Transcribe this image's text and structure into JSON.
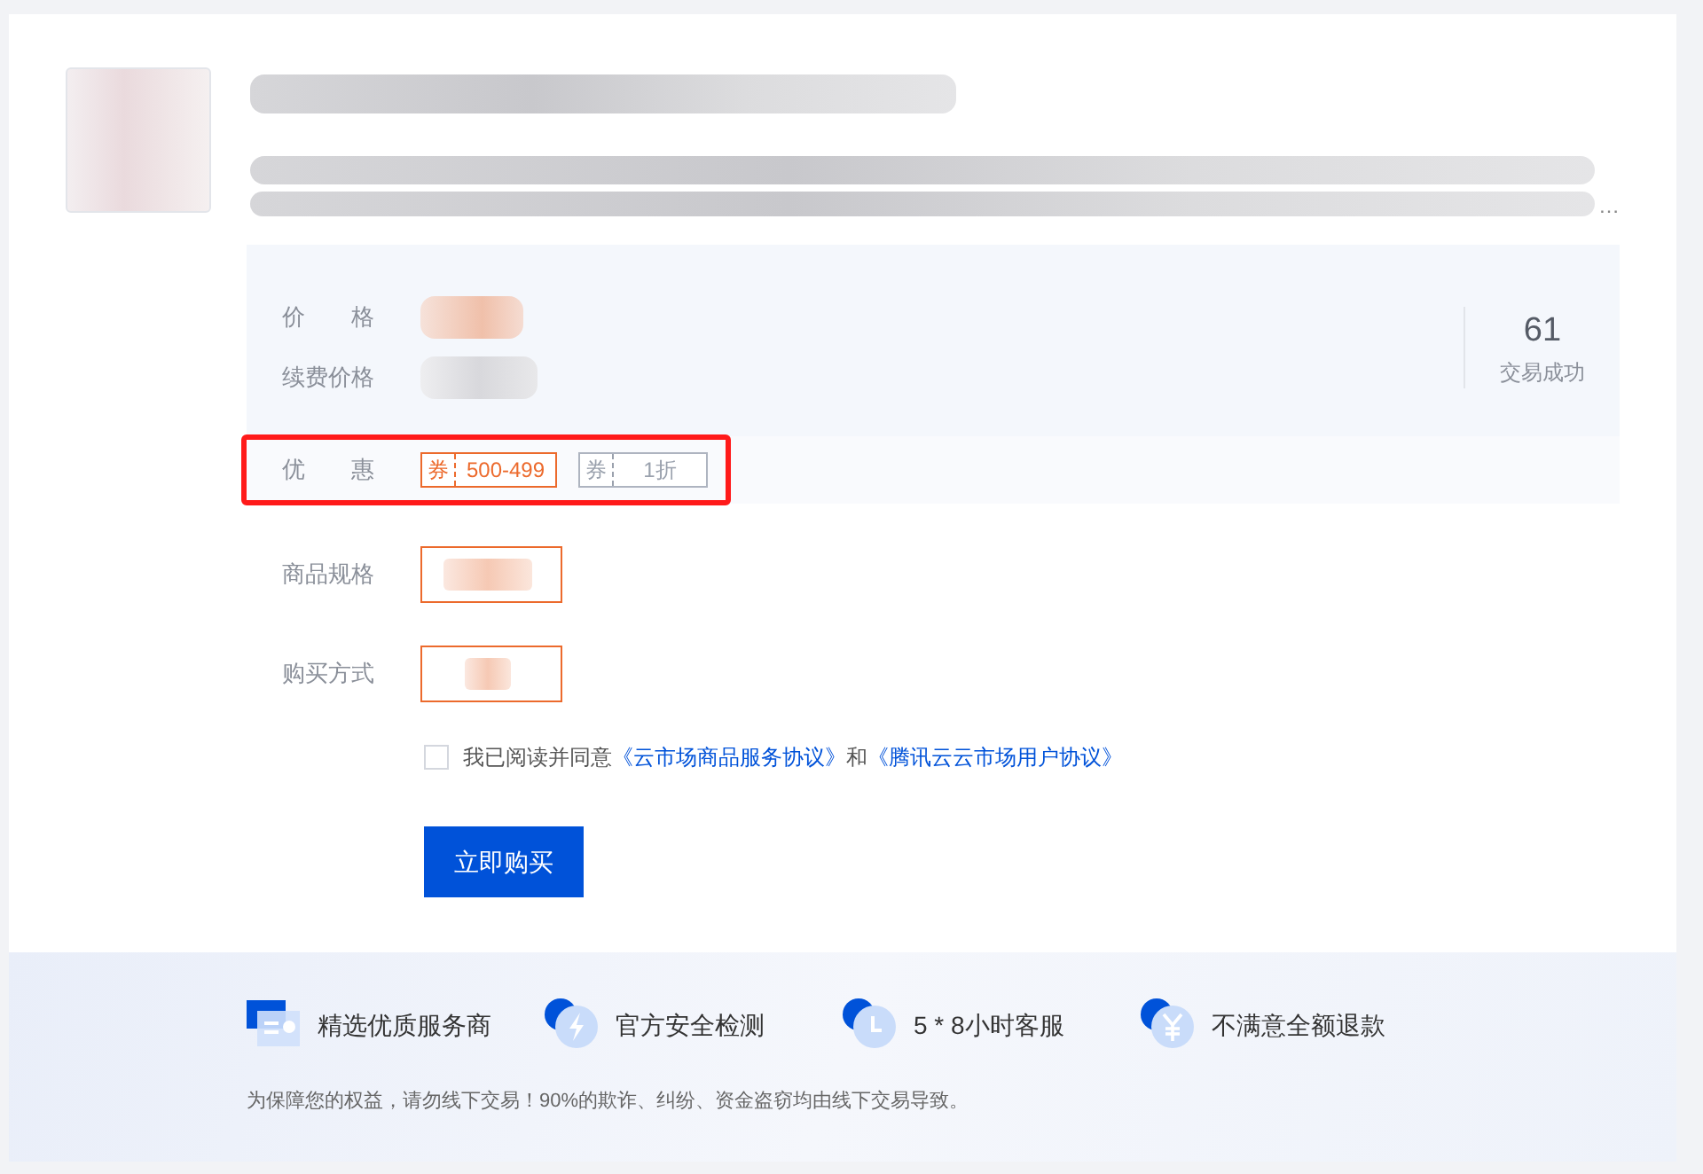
{
  "product": {
    "description_ellipsis": "…"
  },
  "price_panel": {
    "rows": [
      {
        "label": "价　　格",
        "kind": "price"
      },
      {
        "label": "续费价格",
        "kind": "renewal"
      }
    ],
    "stat": {
      "value": "61",
      "label": "交易成功"
    }
  },
  "discount": {
    "label": "优　　惠",
    "highlighted": true,
    "coupons": [
      {
        "tag": "券",
        "text": "500-499",
        "selected": true
      },
      {
        "tag": "券",
        "text": "1折",
        "selected": false
      }
    ]
  },
  "options": [
    {
      "label": "商品规格",
      "kind": "wide"
    },
    {
      "label": "购买方式",
      "kind": "narrow"
    }
  ],
  "agreement": {
    "checked": false,
    "text": "我已阅读并同意",
    "links": [
      "《云市场商品服务协议》",
      "《腾讯云云市场用户协议》"
    ],
    "joiner": "和"
  },
  "buy_button": "立即购买",
  "guarantees": [
    {
      "kind": "certificate",
      "text": "精选优质服务商"
    },
    {
      "kind": "bolt",
      "text": "官方安全检测"
    },
    {
      "kind": "clock",
      "text": "5 * 8小时客服"
    },
    {
      "kind": "yen",
      "text": "不满意全额退款"
    }
  ],
  "notice": "为保障您的权益，请勿线下交易！90%的欺诈、纠纷、资金盗窃均由线下交易导致。"
}
